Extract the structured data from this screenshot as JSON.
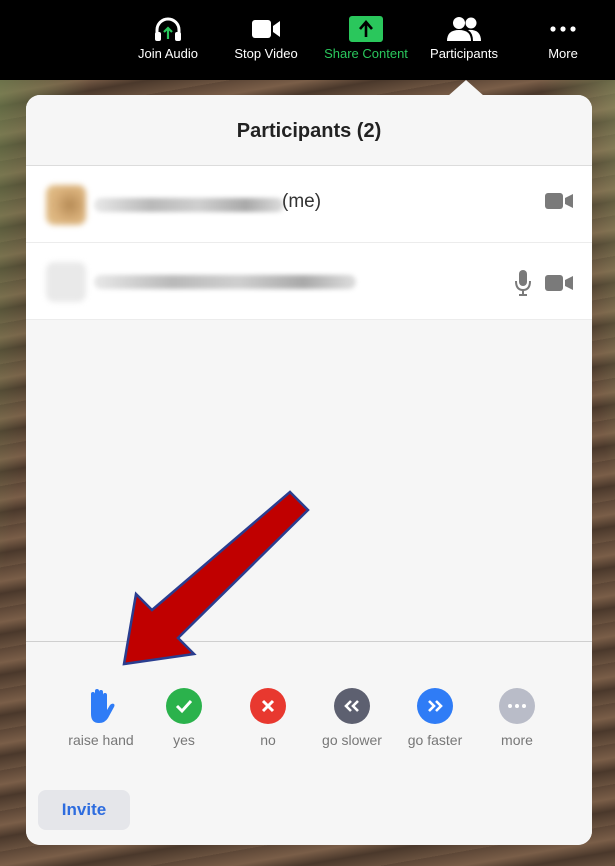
{
  "toolbar": {
    "items": [
      {
        "label": "Join Audio",
        "icon": "headphones-icon"
      },
      {
        "label": "Stop Video",
        "icon": "video-camera-icon"
      },
      {
        "label": "Share Content",
        "icon": "share-arrow-icon"
      },
      {
        "label": "Participants",
        "icon": "people-icon"
      },
      {
        "label": "More",
        "icon": "ellipsis-icon"
      }
    ],
    "accent": "#2ac75c"
  },
  "panel": {
    "title": "Participants (2)",
    "participants": [
      {
        "tag": "(me)",
        "icons": [
          "video-camera-icon"
        ]
      },
      {
        "tag": "",
        "icons": [
          "microphone-icon",
          "video-camera-icon"
        ]
      }
    ]
  },
  "reactions": [
    {
      "label": "raise hand",
      "icon": "raised-hand-icon",
      "color": "#2f7cf6"
    },
    {
      "label": "yes",
      "icon": "checkmark-icon",
      "color": "#2bb24c"
    },
    {
      "label": "no",
      "icon": "x-icon",
      "color": "#e8382f"
    },
    {
      "label": "go slower",
      "icon": "double-chevron-left-icon",
      "color": "#5d6070"
    },
    {
      "label": "go faster",
      "icon": "double-chevron-right-icon",
      "color": "#2f7cf6"
    },
    {
      "label": "more",
      "icon": "ellipsis-icon",
      "color": "#b9bcc8"
    }
  ],
  "invite_label": "Invite",
  "annotation_color": "#c00000"
}
